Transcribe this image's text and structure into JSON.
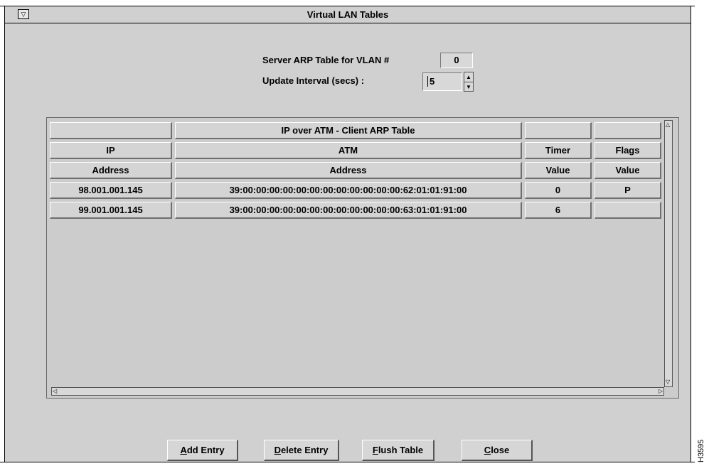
{
  "window": {
    "title": "Virtual LAN Tables",
    "menu_icon": "triangle-down-icon"
  },
  "vlan": {
    "label": "Server ARP Table for VLAN #",
    "value": "0"
  },
  "update": {
    "label": "Update Interval (secs) :",
    "value": "5"
  },
  "table": {
    "title": "IP over ATM - Client ARP Table",
    "header1": [
      "IP",
      "ATM",
      "Timer",
      "Flags"
    ],
    "header2": [
      "Address",
      "Address",
      "Value",
      "Value"
    ],
    "rows": [
      [
        "98.001.001.145",
        "39:00:00:00:00:00:00:00:00:00:00:00:00:62:01:01:91:00",
        "0",
        "P"
      ],
      [
        "99.001.001.145",
        "39:00:00:00:00:00:00:00:00:00:00:00:00:63:01:01:91:00",
        "6",
        ""
      ]
    ]
  },
  "buttons": {
    "add": {
      "mnemonic": "A",
      "rest": "dd Entry"
    },
    "delete": {
      "mnemonic": "D",
      "rest": "elete Entry"
    },
    "flush": {
      "mnemonic": "F",
      "rest": "lush Table"
    },
    "close": {
      "mnemonic": "C",
      "rest": "lose"
    }
  },
  "figure_code": "H3595"
}
